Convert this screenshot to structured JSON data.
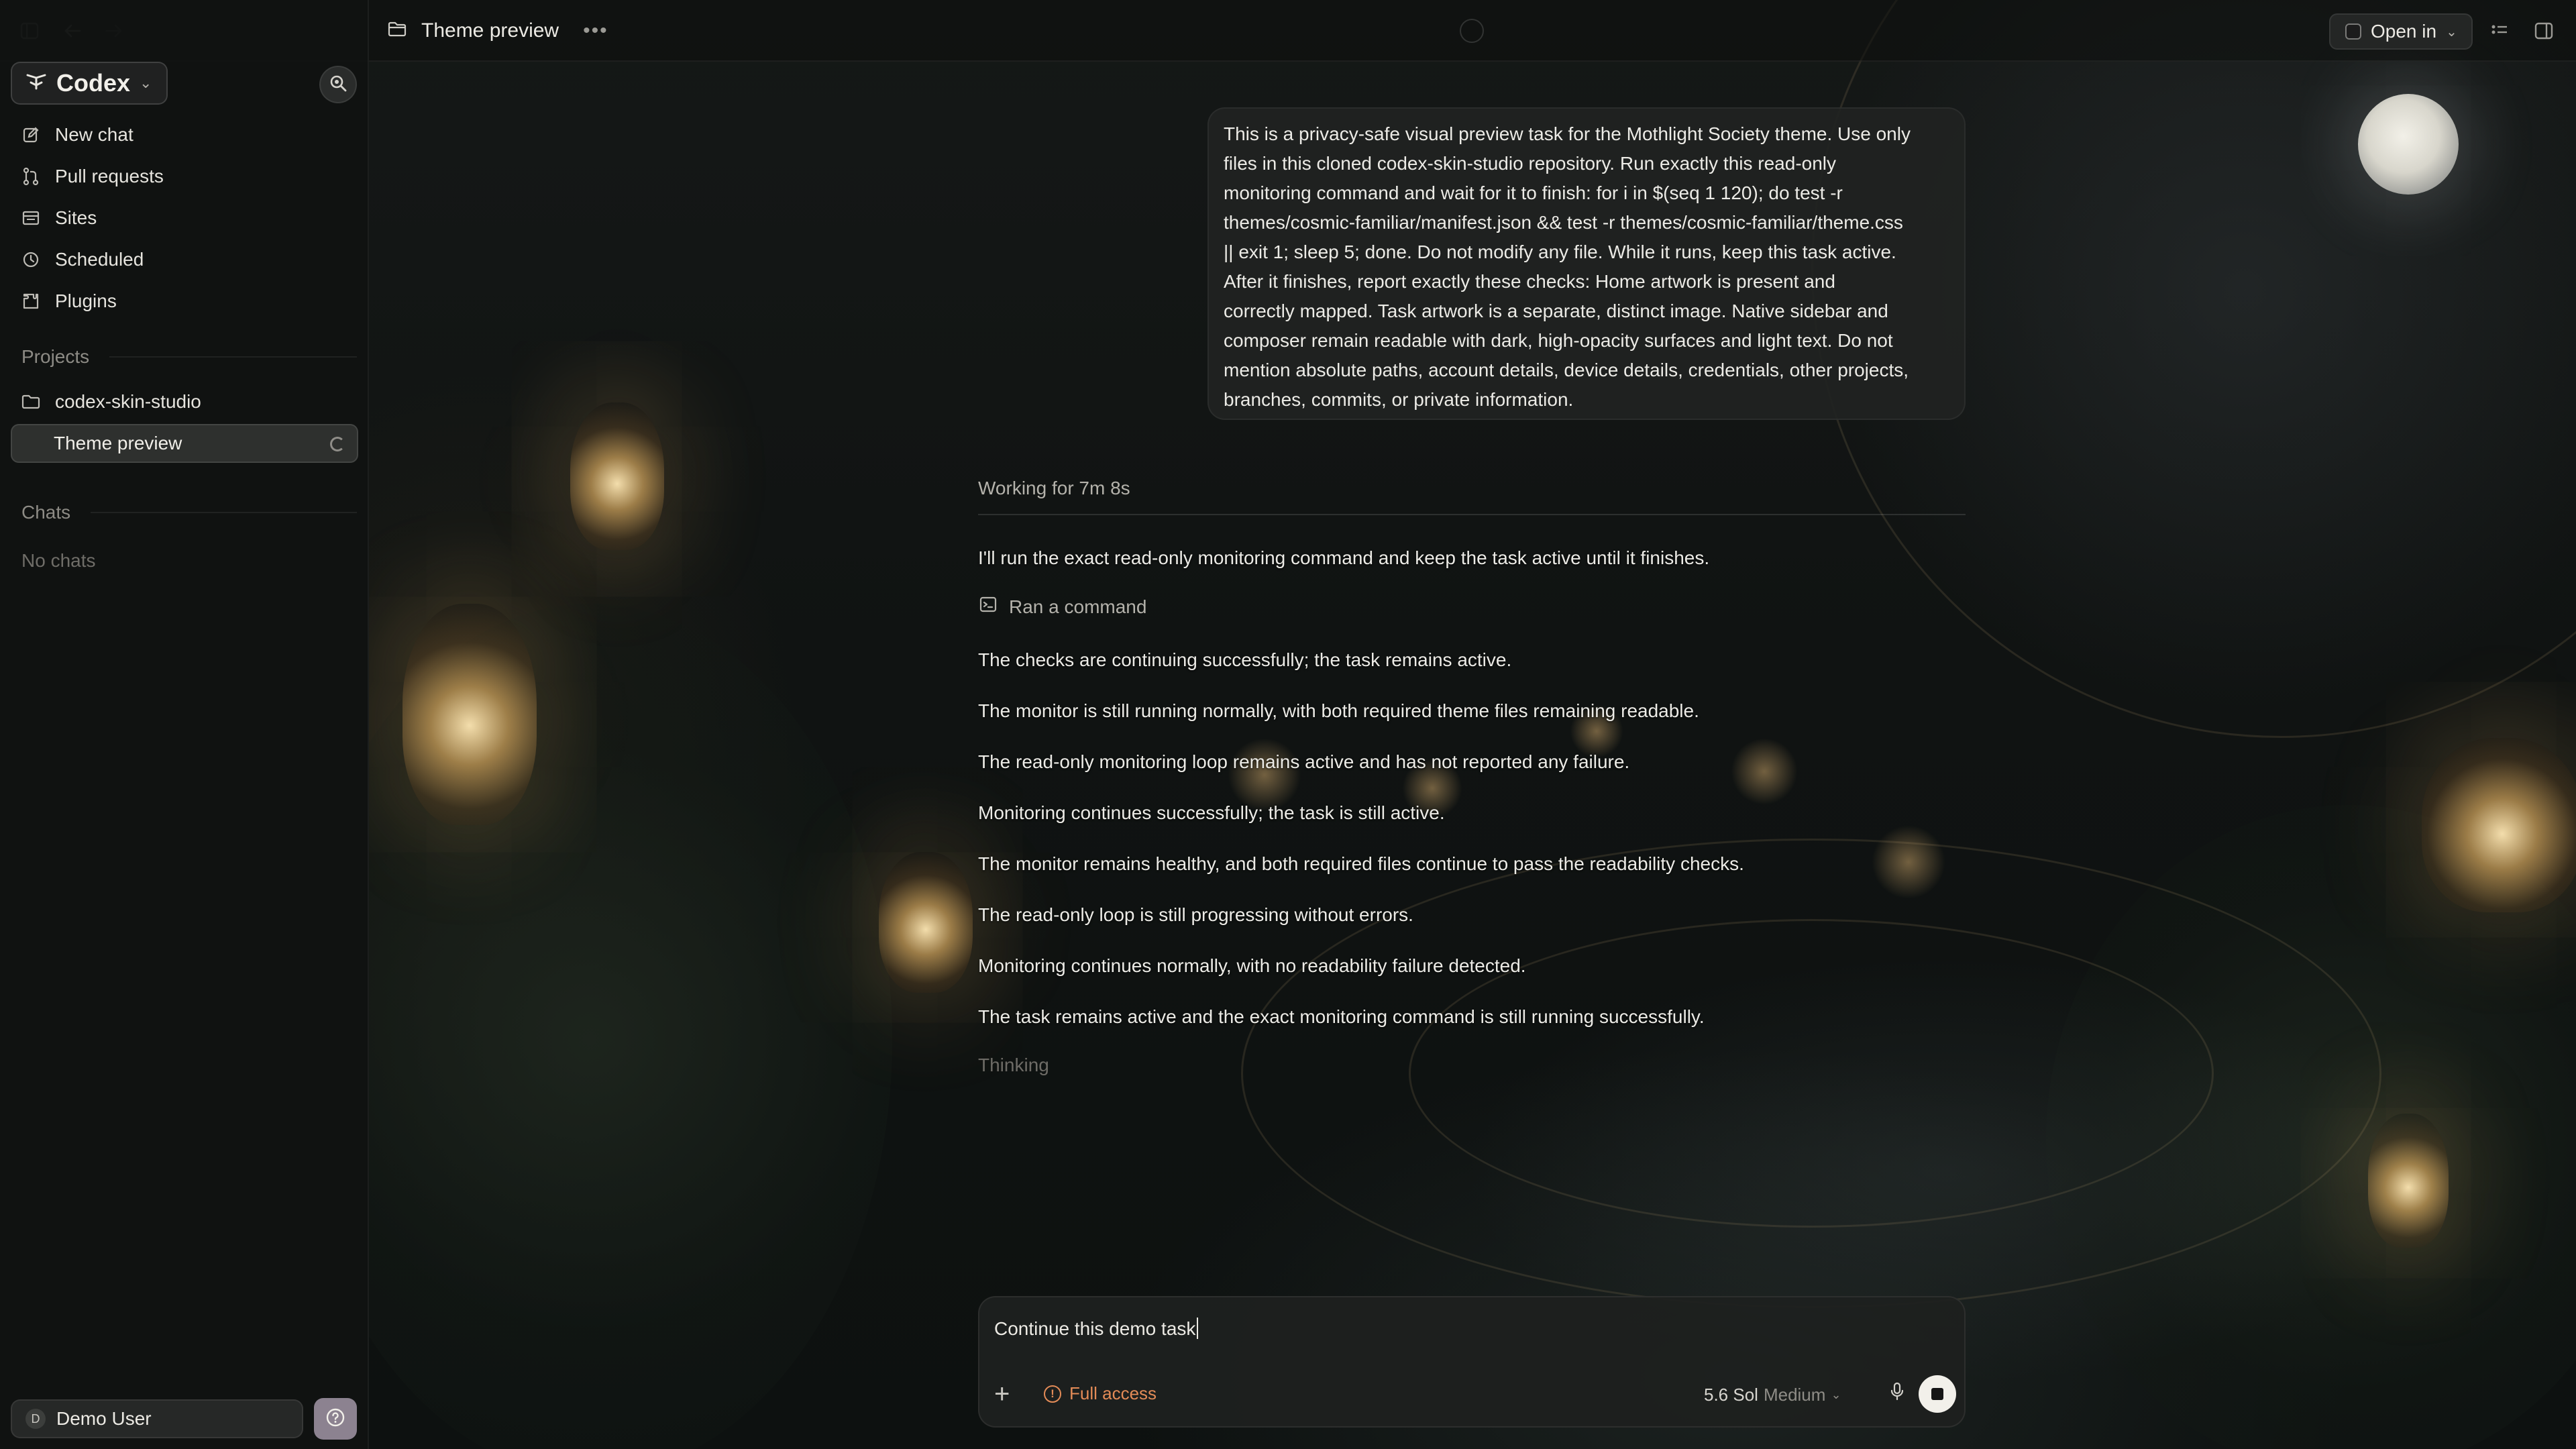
{
  "topbar": {
    "thread_title": "Theme preview",
    "open_in_label": "Open in"
  },
  "sidebar": {
    "brand": "Codex",
    "nav": [
      {
        "label": "New chat",
        "icon": "edit-icon"
      },
      {
        "label": "Pull requests",
        "icon": "pull-request-icon"
      },
      {
        "label": "Sites",
        "icon": "sites-icon"
      },
      {
        "label": "Scheduled",
        "icon": "clock-icon"
      },
      {
        "label": "Plugins",
        "icon": "plugin-icon"
      }
    ],
    "projects_label": "Projects",
    "project_name": "codex-skin-studio",
    "active_thread": "Theme preview",
    "chats_label": "Chats",
    "no_chats": "No chats",
    "user_initial": "D",
    "user_name": "Demo User"
  },
  "conversation": {
    "user_message_lines": [
      "This is a privacy-safe visual preview task for the Mothlight Society theme. Use only",
      "files in this cloned codex-skin-studio repository. Run exactly this read-only",
      "monitoring command and wait for it to finish: for i in $(seq 1 120); do test -r",
      "themes/cosmic-familiar/manifest.json && test -r themes/cosmic-familiar/theme.css",
      "|| exit 1; sleep 5; done. Do not modify any file. While it runs, keep this task active.",
      "After it finishes, report exactly these checks: Home artwork is present and",
      "correctly mapped. Task artwork is a separate, distinct image. Native sidebar and",
      "composer remain readable with dark, high-opacity surfaces and light text. Do not",
      "mention absolute paths, account details, device details, credentials, other projects,",
      "branches, commits, or private information."
    ],
    "working_label": "Working for 7m 8s",
    "first_reply": "I'll run the exact read-only monitoring command and keep the task active until it finishes.",
    "ran_command": "Ran a command",
    "updates": [
      "The checks are continuing successfully; the task remains active.",
      "The monitor is still running normally, with both required theme files remaining readable.",
      "The read-only monitoring loop remains active and has not reported any failure.",
      "Monitoring continues successfully; the task is still active.",
      "The monitor remains healthy, and both required files continue to pass the readability checks.",
      "The read-only loop is still progressing without errors.",
      "Monitoring continues normally, with no readability failure detected.",
      "The task remains active and the exact monitoring command is still running successfully."
    ],
    "thinking": "Thinking"
  },
  "composer": {
    "value": "Continue this demo task",
    "access_label": "Full access",
    "model": "5.6 Sol",
    "effort": "Medium"
  },
  "colors": {
    "accent_warning": "#e38b57",
    "surface": "#1e201f",
    "text": "#ecebe6"
  }
}
